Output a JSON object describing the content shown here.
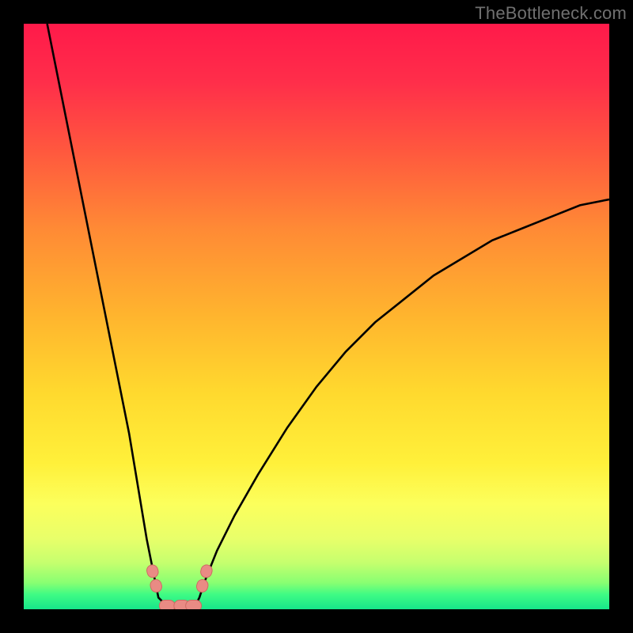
{
  "watermark": "TheBottleneck.com",
  "colors": {
    "frame": "#000000",
    "gradient_stops": [
      {
        "offset": 0.0,
        "color": "#ff1a4a"
      },
      {
        "offset": 0.1,
        "color": "#ff2e4a"
      },
      {
        "offset": 0.22,
        "color": "#ff593e"
      },
      {
        "offset": 0.35,
        "color": "#ff8a35"
      },
      {
        "offset": 0.5,
        "color": "#ffb52e"
      },
      {
        "offset": 0.63,
        "color": "#ffd92e"
      },
      {
        "offset": 0.75,
        "color": "#fff03a"
      },
      {
        "offset": 0.82,
        "color": "#fcff5c"
      },
      {
        "offset": 0.88,
        "color": "#e8ff6a"
      },
      {
        "offset": 0.92,
        "color": "#c6ff6e"
      },
      {
        "offset": 0.955,
        "color": "#88ff72"
      },
      {
        "offset": 0.975,
        "color": "#3efb84"
      },
      {
        "offset": 1.0,
        "color": "#17e68a"
      }
    ],
    "curve": "#000000",
    "marker_fill": "#e98b84",
    "marker_stroke": "#cf6b63"
  },
  "chart_data": {
    "type": "line",
    "title": "",
    "xlabel": "",
    "ylabel": "",
    "x_range": [
      0,
      100
    ],
    "y_range": [
      0,
      100
    ],
    "note": "Bottleneck-style V-curve. y is percent bottleneck (0 = none, 100 = severe). Valley floor sits at y≈0 between x≈23 and x≈30; left branch rises to y≈100 at x≈4; right branch rises to y≈70 at x=100.",
    "series": [
      {
        "name": "bottleneck-curve",
        "x": [
          4,
          6,
          8,
          10,
          12,
          14,
          16,
          18,
          20,
          21,
          22,
          23,
          25,
          27,
          29,
          30,
          31,
          33,
          36,
          40,
          45,
          50,
          55,
          60,
          65,
          70,
          75,
          80,
          85,
          90,
          95,
          100
        ],
        "y": [
          100,
          90,
          80,
          70,
          60,
          50,
          40,
          30,
          18,
          12,
          7,
          2,
          0,
          0,
          0,
          2,
          5,
          10,
          16,
          23,
          31,
          38,
          44,
          49,
          53,
          57,
          60,
          63,
          65,
          67,
          69,
          70
        ]
      }
    ],
    "markers": [
      {
        "name": "left-cluster-a",
        "x": 22.0,
        "y": 6.5
      },
      {
        "name": "left-cluster-b",
        "x": 22.6,
        "y": 4.0
      },
      {
        "name": "floor-a",
        "x": 24.5,
        "y": 0.6
      },
      {
        "name": "floor-b",
        "x": 27.0,
        "y": 0.6
      },
      {
        "name": "floor-c",
        "x": 29.0,
        "y": 0.6
      },
      {
        "name": "right-cluster-a",
        "x": 30.5,
        "y": 4.0
      },
      {
        "name": "right-cluster-b",
        "x": 31.2,
        "y": 6.5
      }
    ]
  }
}
